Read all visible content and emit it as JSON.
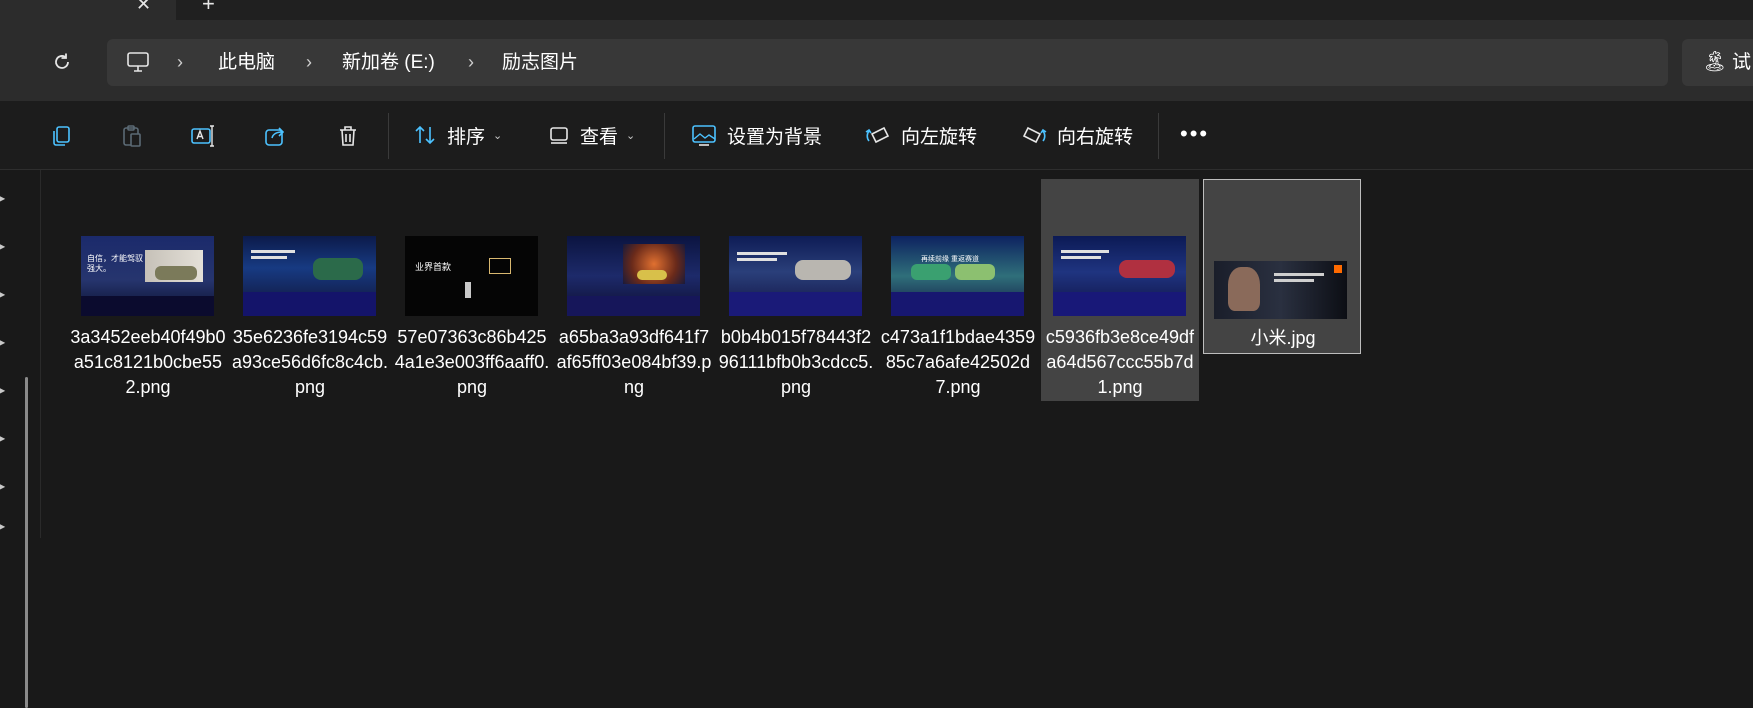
{
  "tabs": {
    "close_glyph": "✕",
    "new_glyph": "+"
  },
  "breadcrumb": [
    "此电脑",
    "新加卷 (E:)",
    "励志图片"
  ],
  "breadcrumb_separator": "›",
  "search": {
    "text": "试",
    "icon": "palm-tree-icon"
  },
  "toolbar": {
    "sort_label": "排序",
    "view_label": "查看",
    "set_background_label": "设置为背景",
    "rotate_left_label": "向左旋转",
    "rotate_right_label": "向右旋转",
    "more_label": "•••"
  },
  "files": [
    {
      "name": "3a3452eeb40f49b0a51c8121b0cbe552.png",
      "caption_line": "自信，才能驾驭强大。"
    },
    {
      "name": "35e6236fe3194c59a93ce56d6fc8c4cb.png"
    },
    {
      "name": "57e07363c86b4254a1e3e003ff6aaff0.png",
      "caption_line": "业界首款"
    },
    {
      "name": "a65ba3a93df641f7af65ff03e084bf39.png"
    },
    {
      "name": "b0b4b015f78443f296111bfb0b3cdcc5.png"
    },
    {
      "name": "c473a1f1bdae435985c7a6afe42502d7.png",
      "caption_line": "再续前缘 重返赛道"
    },
    {
      "name": "c5936fb3e8ce49dfa64d567ccc55b7d1.png"
    },
    {
      "name": "小米.jpg"
    }
  ],
  "colors": {
    "background": "#191919",
    "selected": "#444444",
    "addressbar": "#383838",
    "accent": "#4cc2ff"
  }
}
